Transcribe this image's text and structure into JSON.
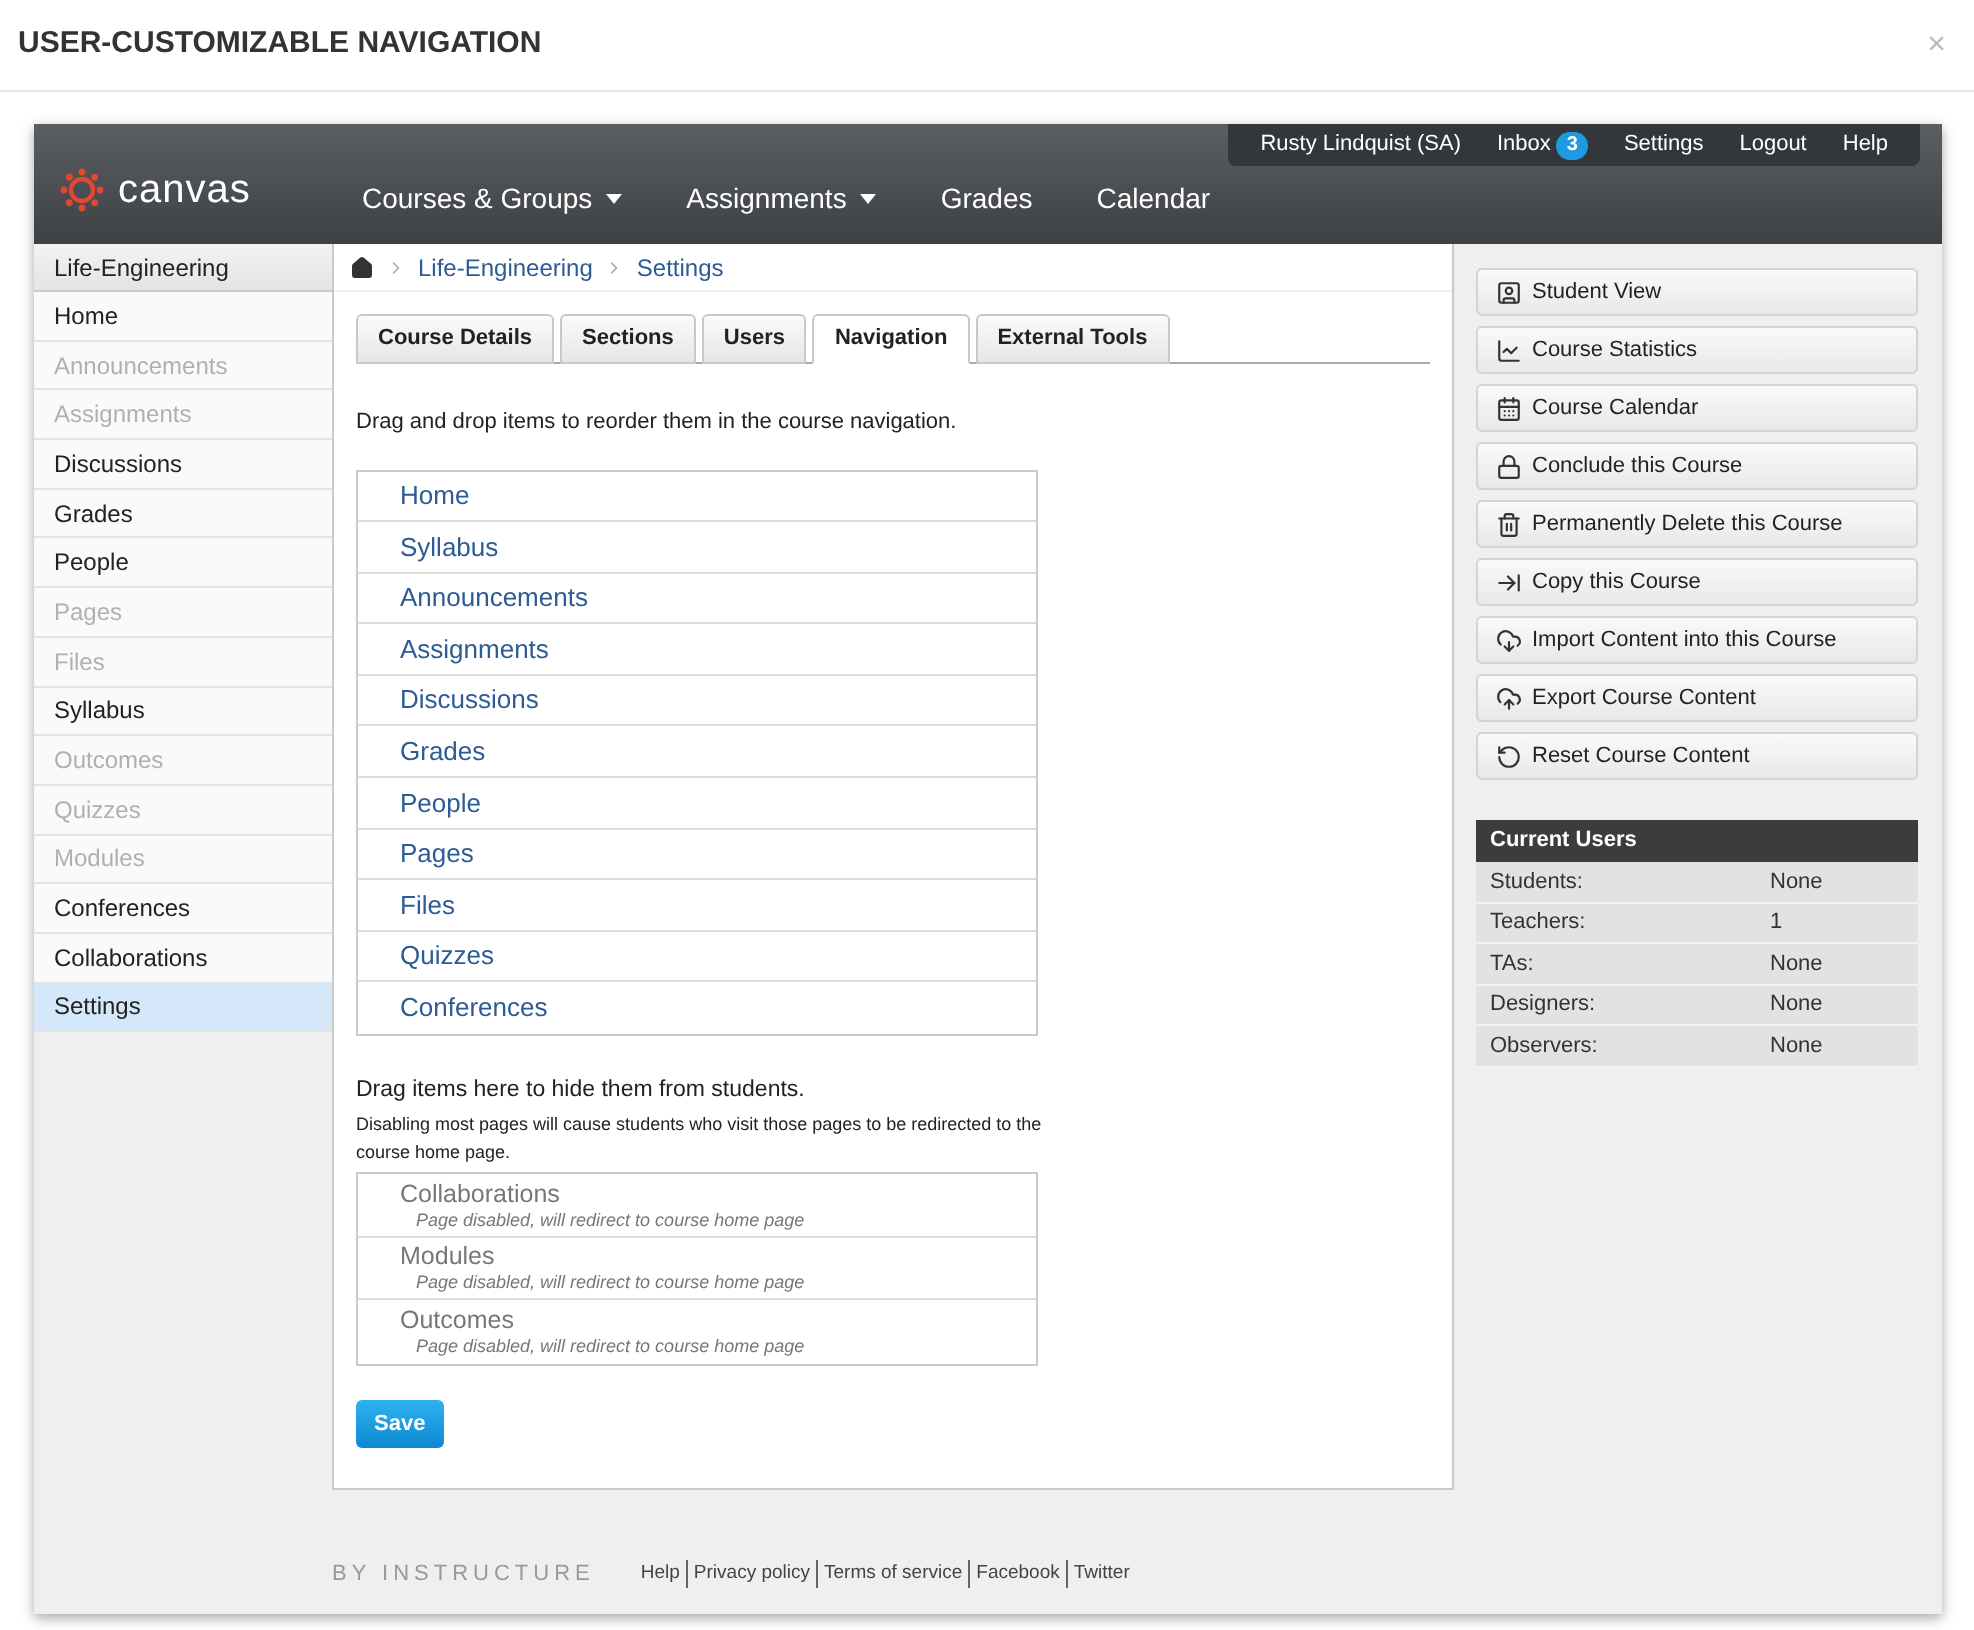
{
  "dialog": {
    "title": "USER-CUSTOMIZABLE NAVIGATION",
    "close": "×"
  },
  "header": {
    "logo": "canvas",
    "user_menu": [
      {
        "label": "Rusty Lindquist (SA)"
      },
      {
        "label": "Inbox",
        "badge": "3"
      },
      {
        "label": "Settings"
      },
      {
        "label": "Logout"
      },
      {
        "label": "Help"
      }
    ],
    "nav": [
      {
        "label": "Courses & Groups",
        "dropdown": true
      },
      {
        "label": "Assignments",
        "dropdown": true
      },
      {
        "label": "Grades",
        "dropdown": false
      },
      {
        "label": "Calendar",
        "dropdown": false
      }
    ]
  },
  "sidebar": {
    "heading": "Life-Engineering",
    "items": [
      {
        "label": "Home",
        "enabled": true,
        "selected": false
      },
      {
        "label": "Announcements",
        "enabled": false,
        "selected": false
      },
      {
        "label": "Assignments",
        "enabled": false,
        "selected": false
      },
      {
        "label": "Discussions",
        "enabled": true,
        "selected": false
      },
      {
        "label": "Grades",
        "enabled": true,
        "selected": false
      },
      {
        "label": "People",
        "enabled": true,
        "selected": false
      },
      {
        "label": "Pages",
        "enabled": false,
        "selected": false
      },
      {
        "label": "Files",
        "enabled": false,
        "selected": false
      },
      {
        "label": "Syllabus",
        "enabled": true,
        "selected": false
      },
      {
        "label": "Outcomes",
        "enabled": false,
        "selected": false
      },
      {
        "label": "Quizzes",
        "enabled": false,
        "selected": false
      },
      {
        "label": "Modules",
        "enabled": false,
        "selected": false
      },
      {
        "label": "Conferences",
        "enabled": true,
        "selected": false
      },
      {
        "label": "Collaborations",
        "enabled": true,
        "selected": false
      },
      {
        "label": "Settings",
        "enabled": true,
        "selected": true
      }
    ]
  },
  "breadcrumb": [
    "Life-Engineering",
    "Settings"
  ],
  "tabs": [
    {
      "label": "Course Details",
      "selected": false
    },
    {
      "label": "Sections",
      "selected": false
    },
    {
      "label": "Users",
      "selected": false
    },
    {
      "label": "Navigation",
      "selected": true
    },
    {
      "label": "External Tools",
      "selected": false
    }
  ],
  "instructions": "Drag and drop items to reorder them in the course navigation.",
  "nav_items": [
    "Home",
    "Syllabus",
    "Announcements",
    "Assignments",
    "Discussions",
    "Grades",
    "People",
    "Pages",
    "Files",
    "Quizzes",
    "Conferences"
  ],
  "hidden_heading": "Drag items here to hide them from students.",
  "hidden_note": "Disabling most pages will cause students who visit those pages to be redirected to the course home page.",
  "hidden_items": [
    {
      "label": "Collaborations",
      "note": "Page disabled, will redirect to course home page"
    },
    {
      "label": "Modules",
      "note": "Page disabled, will redirect to course home page"
    },
    {
      "label": "Outcomes",
      "note": "Page disabled, will redirect to course home page"
    }
  ],
  "save": "Save",
  "actions": [
    "Student View",
    "Course Statistics",
    "Course Calendar",
    "Conclude this Course",
    "Permanently Delete this Course",
    "Copy this Course",
    "Import Content into this Course",
    "Export Course Content",
    "Reset Course Content"
  ],
  "current_users": {
    "title": "Current Users",
    "rows": [
      {
        "label": "Students:",
        "value": "None"
      },
      {
        "label": "Teachers:",
        "value": "1"
      },
      {
        "label": "TAs:",
        "value": "None"
      },
      {
        "label": "Designers:",
        "value": "None"
      },
      {
        "label": "Observers:",
        "value": "None"
      }
    ]
  },
  "footer": {
    "brand": "BY INSTRUCTURE",
    "links": [
      "Help",
      "Privacy policy",
      "Terms of service",
      "Facebook",
      "Twitter"
    ]
  }
}
